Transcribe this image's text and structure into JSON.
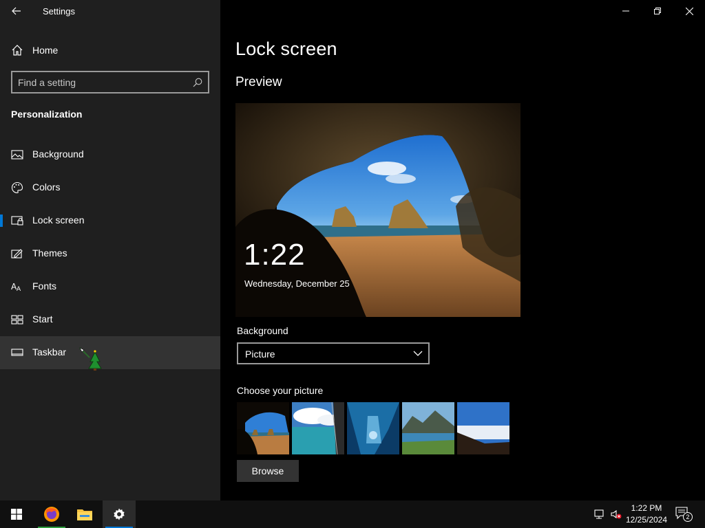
{
  "window": {
    "title": "Settings"
  },
  "sidebar": {
    "home_label": "Home",
    "search_placeholder": "Find a setting",
    "section_title": "Personalization",
    "items": [
      {
        "label": "Background",
        "icon": "picture-icon"
      },
      {
        "label": "Colors",
        "icon": "palette-icon"
      },
      {
        "label": "Lock screen",
        "icon": "lock-screen-icon",
        "selected": true
      },
      {
        "label": "Themes",
        "icon": "themes-icon"
      },
      {
        "label": "Fonts",
        "icon": "fonts-icon"
      },
      {
        "label": "Start",
        "icon": "start-icon"
      },
      {
        "label": "Taskbar",
        "icon": "taskbar-icon",
        "hovered": true
      }
    ]
  },
  "main": {
    "page_title": "Lock screen",
    "preview_title": "Preview",
    "preview_time": "1:22",
    "preview_date": "Wednesday, December 25",
    "background_label": "Background",
    "background_value": "Picture",
    "choose_label": "Choose your picture",
    "browse_label": "Browse"
  },
  "taskbar": {
    "apps": [
      "start-button",
      "firefox",
      "file-explorer",
      "settings"
    ],
    "clock_time": "1:22 PM",
    "clock_date": "12/25/2024",
    "notification_count": "2"
  },
  "colors": {
    "accent": "#0078d7",
    "sidebar_bg": "#1f1f1f",
    "main_bg": "#000000",
    "hover_bg": "#333333"
  }
}
